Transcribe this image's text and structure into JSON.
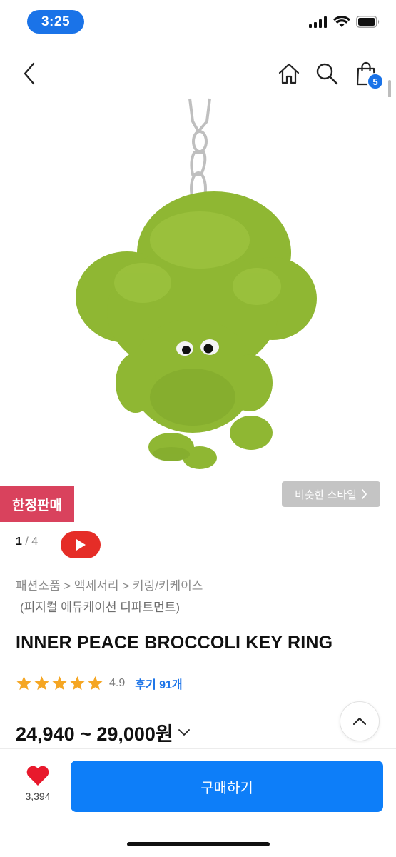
{
  "status": {
    "time": "3:25"
  },
  "header": {
    "back_icon": "chevron-left-icon",
    "home_icon": "home-icon",
    "search_icon": "search-icon",
    "cart_icon": "shopping-bag-icon",
    "cart_count": "5"
  },
  "image": {
    "limited_badge": "한정판매",
    "similar_style": "비슷한 스타일",
    "current_page": "1",
    "total_pages": "4"
  },
  "product": {
    "breadcrumb": "패션소품 > 액세서리 > 키링/키케이스",
    "brand": "(피지컬 에듀케이션 디파트먼트)",
    "title": "INNER PEACE BROCCOLI KEY RING",
    "rating": "4.9",
    "rating_stars": 5,
    "reviews": "후기 91개",
    "price": "24,940 ~ 29,000원"
  },
  "bottom": {
    "like_count": "3,394",
    "buy_label": "구매하기"
  },
  "colors": {
    "accent": "#1a73e8",
    "buy": "#0d7ef9",
    "limited": "#d9425d",
    "star": "#f5a623",
    "heart": "#e8192c",
    "youtube": "#e52d27",
    "broccoli": "#8fb733"
  }
}
